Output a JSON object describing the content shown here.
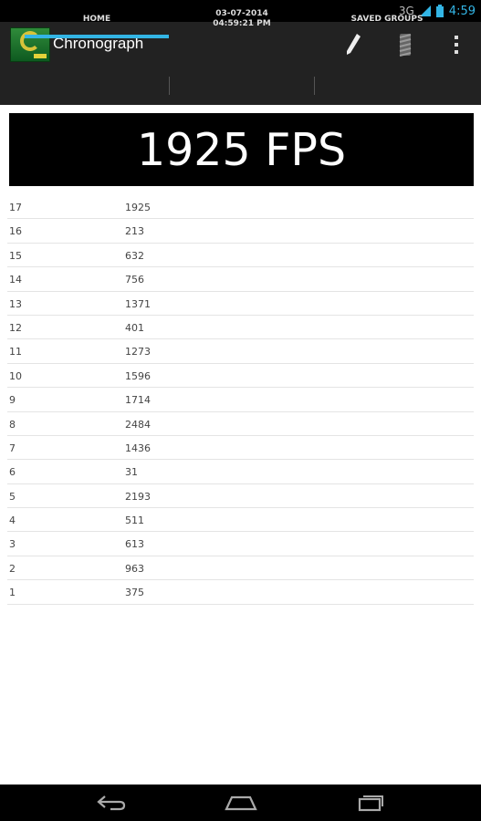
{
  "status_bar": {
    "network": "3G",
    "time": "4:59"
  },
  "action_bar": {
    "title": "Chronograph"
  },
  "tabs": [
    {
      "label": "HOME"
    },
    {
      "label_line1": "03-07-2014",
      "label_line2": "04:59:21 PM"
    },
    {
      "label": "SAVED GROUPS"
    }
  ],
  "banner": {
    "text": "1925 FPS"
  },
  "shots": [
    {
      "n": "17",
      "v": "1925"
    },
    {
      "n": "16",
      "v": "213"
    },
    {
      "n": "15",
      "v": "632"
    },
    {
      "n": "14",
      "v": "756"
    },
    {
      "n": "13",
      "v": "1371"
    },
    {
      "n": "12",
      "v": "401"
    },
    {
      "n": "11",
      "v": "1273"
    },
    {
      "n": "10",
      "v": "1596"
    },
    {
      "n": "9",
      "v": "1714"
    },
    {
      "n": "8",
      "v": "2484"
    },
    {
      "n": "7",
      "v": "1436"
    },
    {
      "n": "6",
      "v": "31"
    },
    {
      "n": "5",
      "v": "2193"
    },
    {
      "n": "4",
      "v": "511"
    },
    {
      "n": "3",
      "v": "613"
    },
    {
      "n": "2",
      "v": "963"
    },
    {
      "n": "1",
      "v": "375"
    }
  ],
  "colors": {
    "accent": "#33b5e5",
    "action_bar": "#222222"
  }
}
